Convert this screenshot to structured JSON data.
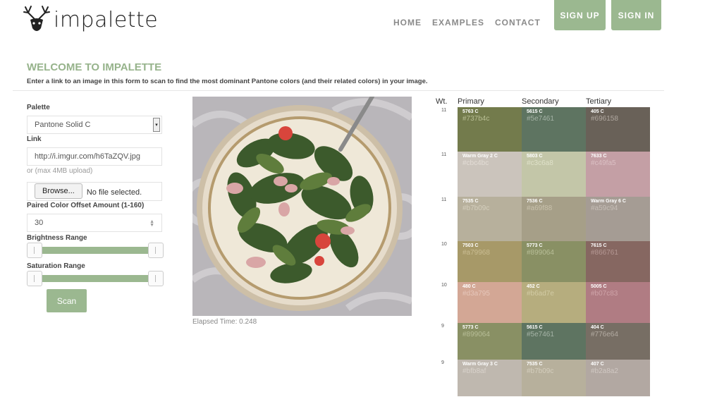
{
  "brand": {
    "name": "impalette"
  },
  "nav": {
    "items": [
      "HOME",
      "EXAMPLES",
      "CONTACT"
    ]
  },
  "auth": {
    "signup": "SIGN UP",
    "signin": "SIGN IN"
  },
  "welcome": {
    "title": "WELCOME TO IMPALETTE",
    "description": "Enter a link to an image in this form to scan to find the most dominant Pantone colors (and their related colors) in your image."
  },
  "form": {
    "palette_label": "Palette",
    "palette_value": "Pantone Solid C",
    "link_label": "Link",
    "link_value": "http://i.imgur.com/h6TaZQV.jpg",
    "upload_hint": "or (max 4MB upload)",
    "browse_label": "Browse...",
    "no_file": "No file selected.",
    "offset_label": "Paired Color Offset Amount (1-160)",
    "offset_value": "30",
    "brightness_label": "Brightness Range",
    "saturation_label": "Saturation Range",
    "scan_label": "Scan"
  },
  "elapsed": "Elapsed Time: 0.248",
  "colors": {
    "headers": {
      "wt": "Wt.",
      "primary": "Primary",
      "secondary": "Secondary",
      "tertiary": "Tertiary"
    },
    "rows": [
      {
        "wt": "11",
        "cells": [
          {
            "name": "5763 C",
            "hex": "#737b4c",
            "label_color": "#b9bf95"
          },
          {
            "name": "5615 C",
            "hex": "#5e7461",
            "label_color": "#a6b4a7"
          },
          {
            "name": "405 C",
            "hex": "#696158",
            "label_color": "#b0a8a0"
          }
        ]
      },
      {
        "wt": "11",
        "cells": [
          {
            "name": "Warm Gray 2 C",
            "hex": "#cbc4bc",
            "label_color": "#e3ddd6"
          },
          {
            "name": "5803 C",
            "hex": "#c3c6a8",
            "label_color": "#dfe1c9"
          },
          {
            "name": "7633 C",
            "hex": "#c49fa5",
            "label_color": "#dbc0c4"
          }
        ]
      },
      {
        "wt": "11",
        "cells": [
          {
            "name": "7535 C",
            "hex": "#b7b09c",
            "label_color": "#d4cebd"
          },
          {
            "name": "7536 C",
            "hex": "#a69f88",
            "label_color": "#c9c2ad"
          },
          {
            "name": "Warm Gray 6 C",
            "hex": "#a59c94",
            "label_color": "#c6beb7"
          }
        ]
      },
      {
        "wt": "10",
        "cells": [
          {
            "name": "7503 C",
            "hex": "#a79968",
            "label_color": "#cabd93"
          },
          {
            "name": "5773 C",
            "hex": "#899064",
            "label_color": "#b8be98"
          },
          {
            "name": "7615 C",
            "hex": "#866761",
            "label_color": "#b59894"
          }
        ]
      },
      {
        "wt": "10",
        "cells": [
          {
            "name": "480 C",
            "hex": "#d3a795",
            "label_color": "#e6c7bb"
          },
          {
            "name": "452 C",
            "hex": "#b6ad7e",
            "label_color": "#d2cba4"
          },
          {
            "name": "5005 C",
            "hex": "#b07c83",
            "label_color": "#cfa4a9"
          }
        ]
      },
      {
        "wt": "9",
        "cells": [
          {
            "name": "5773 C",
            "hex": "#899064",
            "label_color": "#b8be98"
          },
          {
            "name": "5615 C",
            "hex": "#5e7461",
            "label_color": "#a6b4a7"
          },
          {
            "name": "404 C",
            "hex": "#776e64",
            "label_color": "#b3aba2"
          }
        ]
      },
      {
        "wt": "9",
        "cells": [
          {
            "name": "Warm Gray 3 C",
            "hex": "#bfb8af",
            "label_color": "#d9d3cc"
          },
          {
            "name": "7535 C",
            "hex": "#b7b09c",
            "label_color": "#d4cebd"
          },
          {
            "name": "407 C",
            "hex": "#b2a8a2",
            "label_color": "#d0c8c3"
          }
        ]
      }
    ]
  }
}
